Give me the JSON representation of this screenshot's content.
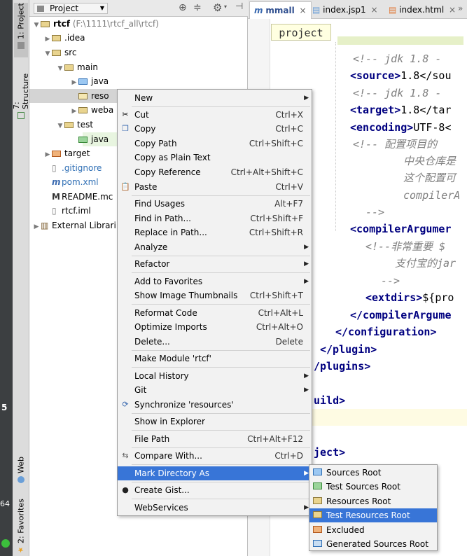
{
  "left_strip": {
    "project_tab": "1: Project",
    "structure_tab": "7: Structure",
    "web_tab": "Web",
    "favorites_tab": "2: Favorites",
    "edge_digits_1": "5",
    "edge_digits_2": "64"
  },
  "project_panel": {
    "header": {
      "view_label": "Project"
    },
    "tree": [
      {
        "label": "rtcf",
        "extra": "(F:\\1111\\rtcf_all\\rtcf)"
      },
      {
        "label": ".idea"
      },
      {
        "label": "src"
      },
      {
        "label": "main"
      },
      {
        "label": "java"
      },
      {
        "label": "reso"
      },
      {
        "label": "weba"
      },
      {
        "label": "test"
      },
      {
        "label": "java"
      },
      {
        "label": "target"
      },
      {
        "label": ".gitignore"
      },
      {
        "label": "pom.xml"
      },
      {
        "label": "README.mc"
      },
      {
        "label": "rtcf.iml"
      },
      {
        "label": "External Librari"
      }
    ]
  },
  "editor": {
    "tabs": [
      {
        "label": "mmall"
      },
      {
        "label": "index.jsp1"
      },
      {
        "label": "index.html"
      }
    ],
    "tooltip": "project",
    "code_lines": [
      {
        "a": "<!--  jdk 1.8 -"
      },
      {
        "a": "<source>",
        "b": "1.8</sou"
      },
      {
        "a": "<!--  jdk 1.8 -"
      },
      {
        "a": "<target>",
        "b": "1.8</tar"
      },
      {
        "a": "<encoding>",
        "b": "UTF-8<"
      },
      {
        "a": "<!--   配置项目的"
      },
      {
        "a": "中央仓库是"
      },
      {
        "a": "这个配置可"
      },
      {
        "a": "compilerA"
      },
      {
        "a": "-->"
      },
      {
        "a": "<compilerArgumer"
      },
      {
        "a": "<!--非常重要  $"
      },
      {
        "a": "支付宝的jar"
      },
      {
        "a": "-->"
      },
      {
        "a": "<extdirs>",
        "b": "${pro"
      },
      {
        "a": "</compilerArgume"
      },
      {
        "a": "</configuration>"
      },
      {
        "a": "</plugin>"
      },
      {
        "a": "/plugins>"
      },
      {
        "a": "uild>"
      },
      {
        "a": "ject>"
      }
    ]
  },
  "context_menu": {
    "items": [
      {
        "label": "New",
        "shortcut": "",
        "submenu": true,
        "icon": ""
      },
      {
        "label": "Cut",
        "shortcut": "Ctrl+X",
        "icon": "cut-icon"
      },
      {
        "label": "Copy",
        "shortcut": "Ctrl+C",
        "icon": "copy-icon"
      },
      {
        "label": "Copy Path",
        "shortcut": "Ctrl+Shift+C"
      },
      {
        "label": "Copy as Plain Text",
        "shortcut": ""
      },
      {
        "label": "Copy Reference",
        "shortcut": "Ctrl+Alt+Shift+C"
      },
      {
        "label": "Paste",
        "shortcut": "Ctrl+V",
        "icon": "paste-icon"
      },
      {
        "label": "Find Usages",
        "shortcut": "Alt+F7"
      },
      {
        "label": "Find in Path...",
        "shortcut": "Ctrl+Shift+F"
      },
      {
        "label": "Replace in Path...",
        "shortcut": "Ctrl+Shift+R"
      },
      {
        "label": "Analyze",
        "shortcut": "",
        "submenu": true
      },
      {
        "label": "Refactor",
        "shortcut": "",
        "submenu": true
      },
      {
        "label": "Add to Favorites",
        "shortcut": "",
        "submenu": true
      },
      {
        "label": "Show Image Thumbnails",
        "shortcut": "Ctrl+Shift+T"
      },
      {
        "label": "Reformat Code",
        "shortcut": "Ctrl+Alt+L"
      },
      {
        "label": "Optimize Imports",
        "shortcut": "Ctrl+Alt+O"
      },
      {
        "label": "Delete...",
        "shortcut": "Delete"
      },
      {
        "label": "Make Module 'rtcf'",
        "shortcut": ""
      },
      {
        "label": "Local History",
        "shortcut": "",
        "submenu": true
      },
      {
        "label": "Git",
        "shortcut": "",
        "submenu": true
      },
      {
        "label": "Synchronize 'resources'",
        "shortcut": "",
        "icon": "sync-icon"
      },
      {
        "label": "Show in Explorer",
        "shortcut": ""
      },
      {
        "label": "File Path",
        "shortcut": "Ctrl+Alt+F12"
      },
      {
        "label": "Compare With...",
        "shortcut": "Ctrl+D",
        "icon": "compare-icon"
      },
      {
        "label": "Mark Directory As",
        "shortcut": "",
        "submenu": true
      },
      {
        "label": "Create Gist...",
        "shortcut": "",
        "icon": "github-icon"
      },
      {
        "label": "WebServices",
        "shortcut": "",
        "submenu": true
      }
    ]
  },
  "mark_directory_submenu": {
    "items": [
      {
        "label": "Sources Root",
        "color": "#5a9bd5"
      },
      {
        "label": "Test Sources Root",
        "color": "#5cb85c"
      },
      {
        "label": "Resources Root",
        "color": "#c59d3f"
      },
      {
        "label": "Test Resources Root",
        "color": "#c59d3f"
      },
      {
        "label": "Excluded",
        "color": "#e07a3a"
      },
      {
        "label": "Generated Sources Root",
        "color": "#5a9bd5"
      }
    ]
  },
  "colors": {
    "selection": "#3875d7",
    "menu_bg": "#f2f2f2",
    "xml_tag": "#000080",
    "comment": "#808080"
  }
}
